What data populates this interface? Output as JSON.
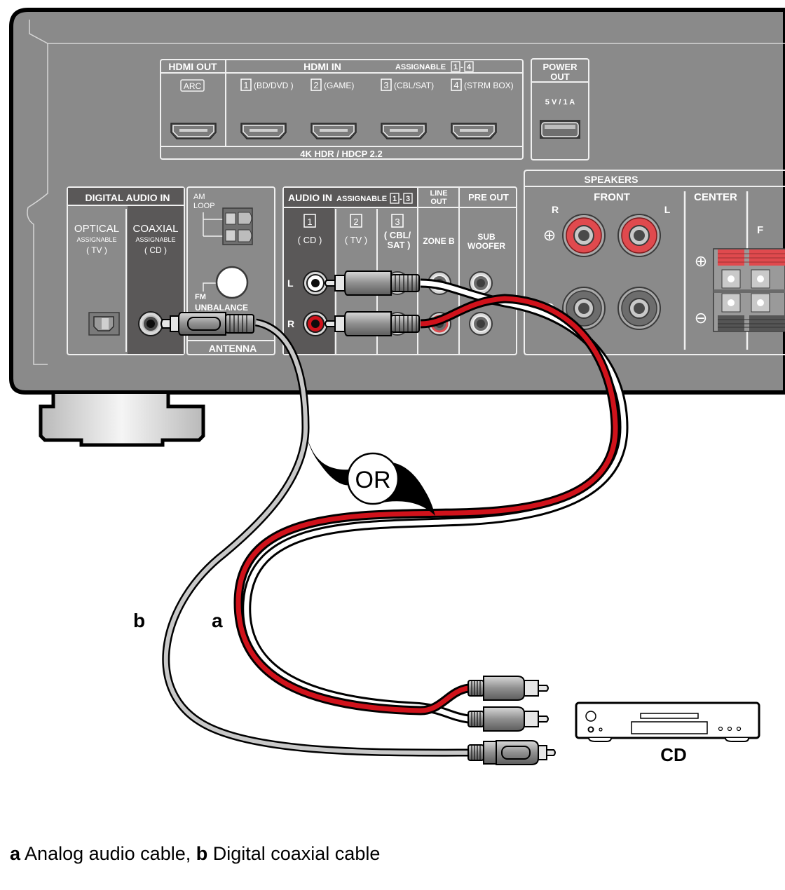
{
  "receiver": {
    "hdmi_out": {
      "title": "HDMI OUT",
      "badge": "ARC"
    },
    "hdmi_in": {
      "title": "HDMI IN",
      "assignable_label": "ASSIGNABLE",
      "assignable_range": [
        "1",
        "4"
      ],
      "ports": [
        {
          "num": "1",
          "label": "(BD/DVD )"
        },
        {
          "num": "2",
          "label": "(GAME)"
        },
        {
          "num": "3",
          "label": "(CBL/SAT)"
        },
        {
          "num": "4",
          "label": "(STRM BOX)"
        }
      ],
      "footer": "4K HDR / HDCP 2.2"
    },
    "power_out": {
      "title_line1": "POWER",
      "title_line2": "OUT",
      "rating": "5 V / 1 A"
    },
    "digital_audio_in": {
      "title": "DIGITAL AUDIO IN",
      "optical": {
        "name": "OPTICAL",
        "sub": "ASSIGNABLE",
        "source": "( TV )"
      },
      "coaxial": {
        "name": "COAXIAL",
        "sub": "ASSIGNABLE",
        "source": "( CD )"
      }
    },
    "antenna": {
      "am_line1": "AM",
      "am_line2": "LOOP",
      "fm_line1": "FM",
      "fm_line2": "UNBALANCE",
      "footer": "ANTENNA"
    },
    "audio_in": {
      "title": "AUDIO IN",
      "assignable_label": "ASSIGNABLE",
      "assignable_range": [
        "1",
        "3"
      ],
      "inputs": [
        {
          "num": "1",
          "label": "( CD )"
        },
        {
          "num": "2",
          "label": "( TV )"
        },
        {
          "num": "3",
          "label_line1": "( CBL/",
          "label_line2": "SAT )"
        }
      ],
      "channel_left": "L",
      "channel_right": "R"
    },
    "line_out": {
      "title_line1": "LINE",
      "title_line2": "OUT",
      "zone": "ZONE B"
    },
    "pre_out": {
      "title": "PRE OUT",
      "sub_line1": "SUB",
      "sub_line2": "WOOFER"
    },
    "speakers": {
      "title": "SPEAKERS",
      "front": {
        "title": "FRONT",
        "right": "R",
        "left": "L"
      },
      "center": {
        "title": "CENTER"
      },
      "next_section_initial": "F",
      "plus_symbol": "⊕",
      "minus_symbol": "⊖"
    }
  },
  "callout": {
    "text": "OR"
  },
  "cable_labels": {
    "a": "a",
    "b": "b"
  },
  "device": {
    "label": "CD"
  },
  "caption": {
    "a_key": "a",
    "a_text": " Analog audio cable, ",
    "b_key": "b",
    "b_text": " Digital coaxial cable"
  },
  "colors": {
    "panel": "#8a8a8a",
    "panel_dark": "#5a5858",
    "outline": "#000000",
    "cable_red": "#d0121b",
    "cable_white": "#ffffff",
    "cable_grey": "#c8c8c8",
    "binding_post_red": "#e04a4e"
  }
}
